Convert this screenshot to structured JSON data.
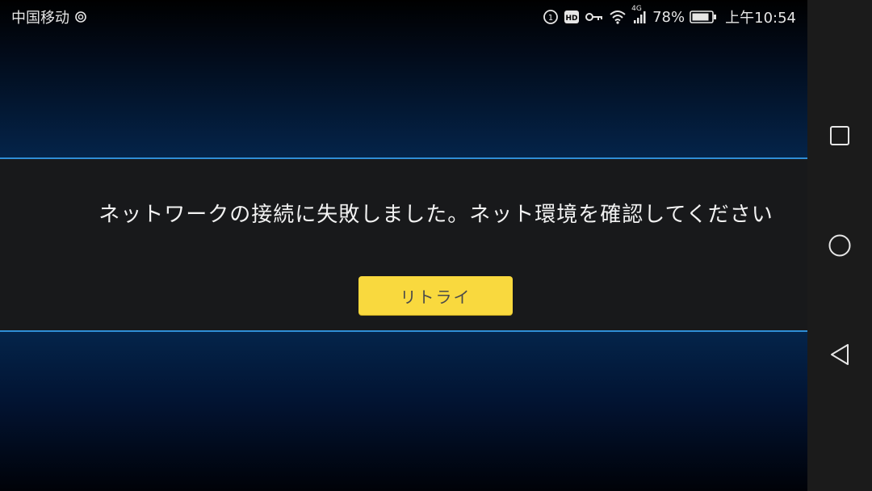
{
  "status_bar": {
    "carrier": "中国移动",
    "network_type": "4G",
    "battery": "78%",
    "time": "上午10:54",
    "icons": [
      "carrier-signal-icon",
      "volte-icon",
      "hd-icon",
      "key-icon",
      "wifi-icon",
      "cellular-signal-icon",
      "battery-icon"
    ]
  },
  "dialog": {
    "message": "ネットワークの接続に失敗しました。ネット環境を確認してください",
    "retry_label": "リトライ"
  },
  "navigation": {
    "buttons": [
      "recents-button",
      "home-button",
      "back-button"
    ]
  },
  "colors": {
    "accent_line": "#2f8ed6",
    "retry_button": "#f9d93e",
    "dialog_bg": "#18191b",
    "navbar_bg": "#1b1b1b"
  }
}
